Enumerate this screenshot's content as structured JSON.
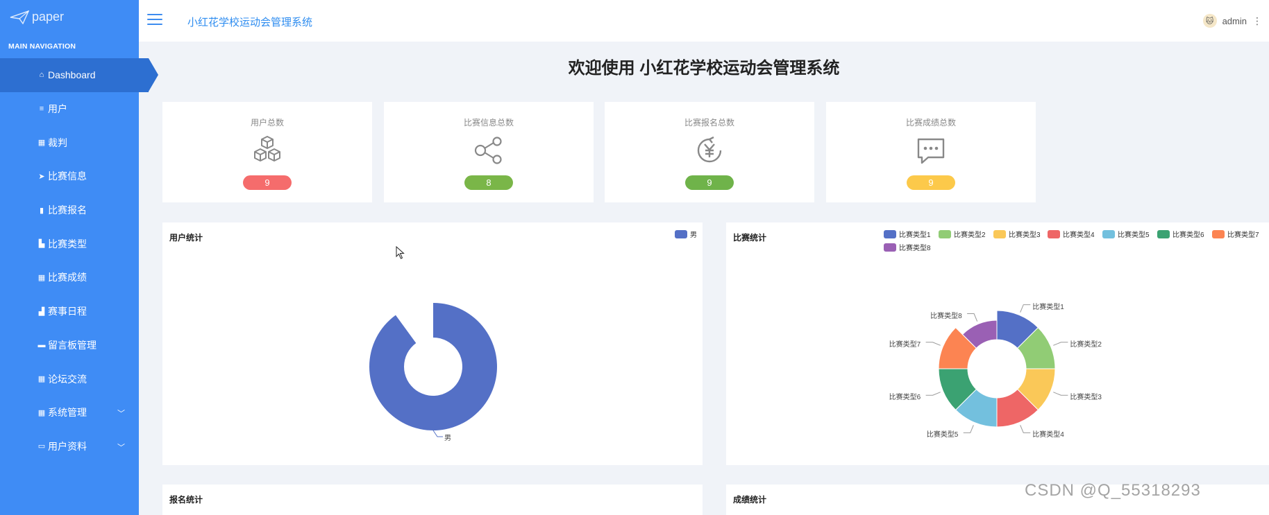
{
  "sidebar": {
    "logo_text": "paper",
    "nav_title": "MAIN NAVIGATION",
    "items": [
      {
        "label": "Dashboard",
        "icon": "home-icon"
      },
      {
        "label": "用户",
        "icon": "list-icon"
      },
      {
        "label": "裁判",
        "icon": "grid-icon"
      },
      {
        "label": "比赛信息",
        "icon": "send-icon"
      },
      {
        "label": "比赛报名",
        "icon": "clipboard-icon"
      },
      {
        "label": "比赛类型",
        "icon": "book-icon"
      },
      {
        "label": "比赛成绩",
        "icon": "grid-icon"
      },
      {
        "label": "赛事日程",
        "icon": "bar-chart-icon"
      },
      {
        "label": "留言板管理",
        "icon": "chat-icon"
      },
      {
        "label": "论坛交流",
        "icon": "grid-icon"
      },
      {
        "label": "系统管理",
        "icon": "grid-icon"
      },
      {
        "label": "用户资料",
        "icon": "id-card-icon"
      }
    ]
  },
  "header": {
    "title": "小红花学校运动会管理系统",
    "username": "admin"
  },
  "welcome": "欢迎使用 小红花学校运动会管理系统",
  "stats": [
    {
      "label": "用户总数",
      "value": "9",
      "color": "#f56c6c",
      "icon": "cubes-icon"
    },
    {
      "label": "比赛信息总数",
      "value": "8",
      "color": "#7ab648",
      "icon": "share-icon"
    },
    {
      "label": "比赛报名总数",
      "value": "9",
      "color": "#6fb34a",
      "icon": "yen-icon"
    },
    {
      "label": "比赛成绩总数",
      "value": "9",
      "color": "#fcc94a",
      "icon": "message-icon"
    }
  ],
  "panels": {
    "user_stats": "用户统计",
    "match_stats": "比赛统计",
    "signup_stats": "报名统计",
    "score_stats": "成绩统计"
  },
  "chart_data": [
    {
      "type": "pie",
      "title": "用户统计",
      "categories": [
        "男"
      ],
      "values": [
        1
      ],
      "colors": [
        "#5470c6"
      ]
    },
    {
      "type": "pie",
      "title": "比赛统计",
      "categories": [
        "比赛类型1",
        "比赛类型2",
        "比赛类型3",
        "比赛类型4",
        "比赛类型5",
        "比赛类型6",
        "比赛类型7",
        "比赛类型8"
      ],
      "values": [
        1,
        1,
        1,
        1,
        1,
        1,
        1,
        1
      ],
      "colors": [
        "#5470c6",
        "#91cc75",
        "#fac858",
        "#ee6666",
        "#73c0de",
        "#3ba272",
        "#fc8452",
        "#9a60b4"
      ]
    }
  ],
  "watermark": "CSDN @Q_55318293"
}
